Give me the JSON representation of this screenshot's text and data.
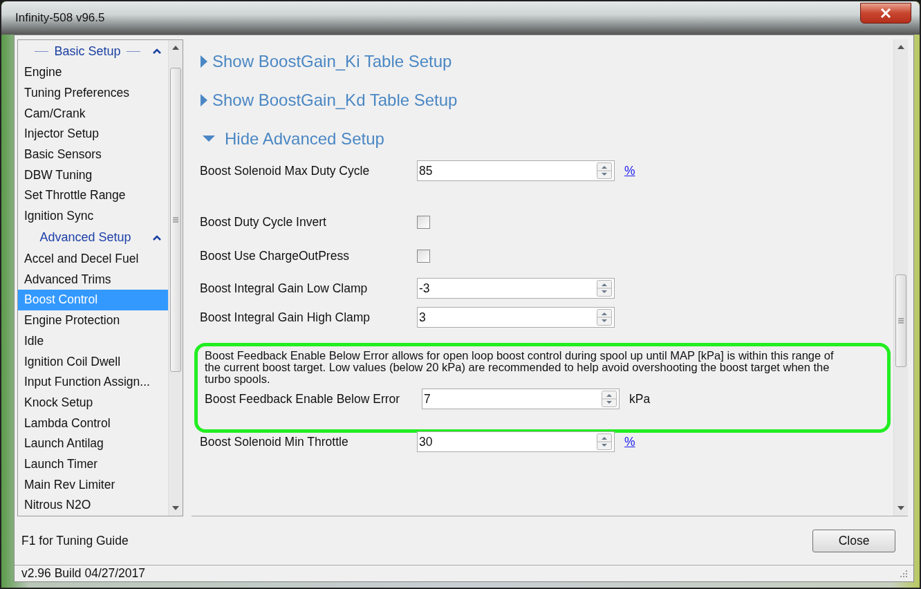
{
  "window": {
    "title": "Infinity-508 v96.5"
  },
  "sidebar": {
    "groups": [
      {
        "title": "Basic Setup",
        "focused": true,
        "expanded": true,
        "items": [
          {
            "label": "Engine",
            "selected": false
          },
          {
            "label": "Tuning Preferences",
            "selected": false
          },
          {
            "label": "Cam/Crank",
            "selected": false
          },
          {
            "label": "Injector Setup",
            "selected": false
          },
          {
            "label": "Basic Sensors",
            "selected": false
          },
          {
            "label": "DBW Tuning",
            "selected": false
          },
          {
            "label": "Set Throttle Range",
            "selected": false
          },
          {
            "label": "Ignition Sync",
            "selected": false
          }
        ]
      },
      {
        "title": "Advanced Setup",
        "focused": false,
        "expanded": true,
        "items": [
          {
            "label": "Accel and Decel Fuel",
            "selected": false
          },
          {
            "label": "Advanced Trims",
            "selected": false
          },
          {
            "label": "Boost Control",
            "selected": true
          },
          {
            "label": "Engine Protection",
            "selected": false
          },
          {
            "label": "Idle",
            "selected": false
          },
          {
            "label": "Ignition Coil Dwell",
            "selected": false
          },
          {
            "label": "Input Function Assign...",
            "selected": false
          },
          {
            "label": "Knock Setup",
            "selected": false
          },
          {
            "label": "Lambda Control",
            "selected": false
          },
          {
            "label": "Launch Antilag",
            "selected": false
          },
          {
            "label": "Launch Timer",
            "selected": false
          },
          {
            "label": "Main Rev Limiter",
            "selected": false
          },
          {
            "label": "Nitrous N2O",
            "selected": false
          }
        ]
      }
    ]
  },
  "content": [
    {
      "kind": "expander",
      "label": "Show BoostGain_Ki Table Setup",
      "expanded": false
    },
    {
      "kind": "expander",
      "label": "Show BoostGain_Kd Table Setup",
      "expanded": false
    },
    {
      "kind": "expander",
      "label": "Hide Advanced Setup",
      "expanded": true
    },
    {
      "kind": "spin",
      "label": "Boost Solenoid Max Duty Cycle",
      "value": "85",
      "unit": "%",
      "unit_link": true
    },
    {
      "kind": "checkbox",
      "label": "Boost Duty Cycle Invert",
      "checked": false
    },
    {
      "kind": "checkbox",
      "label": "Boost Use ChargeOutPress",
      "checked": false
    },
    {
      "kind": "spin",
      "label": "Boost Integral Gain Low Clamp",
      "value": "-3"
    },
    {
      "kind": "spin",
      "label": "Boost Integral Gain High Clamp",
      "value": "3"
    },
    {
      "kind": "highlight",
      "text": "Boost Feedback Enable Below Error allows for open loop boost control during spool up until MAP [kPa] is within this range of the current boost target.  Low values (below 20 kPa) are recommended to help avoid overshooting the boost target when the turbo spools.",
      "field": {
        "label": "Boost Feedback Enable Below Error",
        "value": "7",
        "unit": "kPa",
        "unit_link": false
      }
    },
    {
      "kind": "spin",
      "label": "Boost Solenoid Min Throttle",
      "value": "30",
      "unit": "%",
      "unit_link": true
    }
  ],
  "footer": {
    "hint": "F1 for Tuning Guide",
    "button": "Close"
  },
  "status_bar": "v2.96 Build 04/27/2017"
}
